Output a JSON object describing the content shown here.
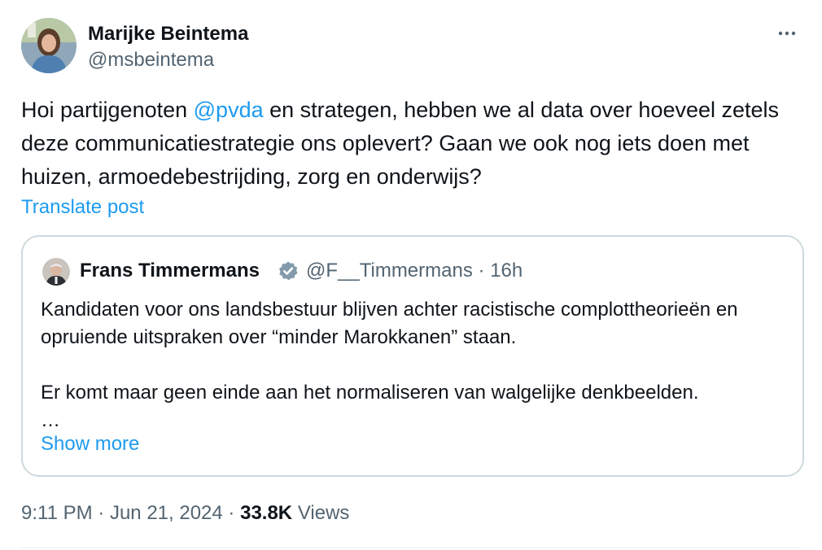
{
  "author": {
    "display_name": "Marijke Beintema",
    "handle": "@msbeintema",
    "avatar_icon": "profile-photo-icon"
  },
  "more_icon": "more-horizontal-icon",
  "tweet": {
    "text_before_mention": "Hoi partijgenoten ",
    "mention": "@pvda",
    "text_after_mention": " en strategen, hebben we al data over hoeveel zetels deze communicatiestrategie ons oplevert? Gaan we ook nog iets doen met huizen, armoedebestrijding, zorg en onderwijs?",
    "translate_label": "Translate post"
  },
  "quoted": {
    "display_name": "Frans Timmermans",
    "verified_icon": "verified-badge-icon",
    "handle": "@F__Timmermans",
    "separator": "·",
    "time": "16h",
    "paragraph_1": "Kandidaten voor ons landsbestuur blijven achter racistische complottheorieën en opruiende uitspraken over “minder Marokkanen” staan.",
    "paragraph_2": "Er komt maar geen einde aan het normaliseren van walgelijke denkbeelden.",
    "ellipsis": "…",
    "show_more_label": "Show more"
  },
  "meta": {
    "time": "9:11 PM",
    "separator": "·",
    "date": "Jun 21, 2024",
    "views_count": "33.8K",
    "views_label": "Views"
  },
  "colors": {
    "accent": "#1d9bf0",
    "text": "#0f1419",
    "secondary": "#536471",
    "border": "#cfd9de"
  }
}
